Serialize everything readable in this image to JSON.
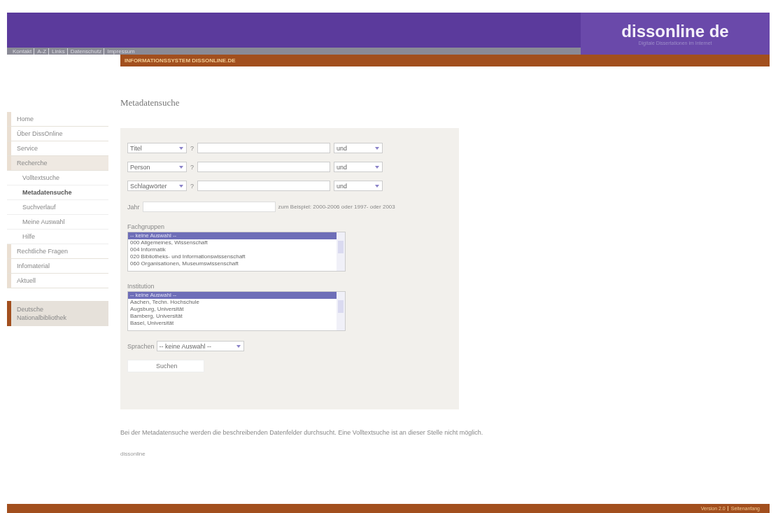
{
  "header": {
    "logo": "dissonline de",
    "tagline": "Digitale Dissertationen im Internet",
    "top_links": [
      "Kontakt",
      "A-Z",
      "Links",
      "Datenschutz",
      "Impressum"
    ],
    "banner": "INFORMATIONSSYSTEM DISSONLINE.DE"
  },
  "sidebar": {
    "items": [
      {
        "label": "Home",
        "selected": false
      },
      {
        "label": "Über DissOnline",
        "selected": false
      },
      {
        "label": "Service",
        "selected": false
      },
      {
        "label": "Recherche",
        "selected": true,
        "children": [
          {
            "label": "Volltextsuche",
            "selected": false
          },
          {
            "label": "Metadatensuche",
            "selected": true
          },
          {
            "label": "Suchverlauf",
            "selected": false
          },
          {
            "label": "Meine Auswahl",
            "selected": false
          },
          {
            "label": "Hilfe",
            "selected": false
          }
        ]
      },
      {
        "label": "Rechtliche Fragen",
        "selected": false
      },
      {
        "label": "Infomaterial",
        "selected": false
      },
      {
        "label": "Aktuell",
        "selected": false
      }
    ],
    "partner": "Deutsche Nationalbibliothek"
  },
  "page_title": "Metadatensuche",
  "search_rows": [
    {
      "field": "Titel",
      "help": "?",
      "operator": "und"
    },
    {
      "field": "Person",
      "help": "?",
      "operator": "und"
    },
    {
      "field": "Schlagwörter",
      "help": "?",
      "operator": "und"
    }
  ],
  "year": {
    "label": "Jahr",
    "hint": "zum Beispiel: 2000-2006 oder 1997- oder 2003"
  },
  "lists": [
    {
      "label": "Fachgruppen",
      "options": [
        {
          "label": "-- keine Auswahl --",
          "selected": true
        },
        {
          "label": "000 Allgemeines, Wissenschaft",
          "selected": false
        },
        {
          "label": "004 Informatik",
          "selected": false
        },
        {
          "label": "020 Bibliotheks- und Informationswissenschaft",
          "selected": false
        },
        {
          "label": "060 Organisationen, Museumswissenschaft",
          "selected": false
        }
      ]
    },
    {
      "label": "Institution",
      "options": [
        {
          "label": "-- keine Auswahl --",
          "selected": true
        },
        {
          "label": "Aachen, Techn. Hochschule",
          "selected": false
        },
        {
          "label": "Augsburg, Universität",
          "selected": false
        },
        {
          "label": "Bamberg, Universität",
          "selected": false
        },
        {
          "label": "Basel, Universität",
          "selected": false
        }
      ]
    }
  ],
  "language": {
    "label": "Sprachen",
    "value": "-- keine Auswahl --"
  },
  "submit": "Suchen",
  "note": "Bei der Metadatensuche werden die beschreibenden Datenfelder durchsucht. Eine Volltextsuche ist an dieser Stelle nicht möglich.",
  "footer_link": "dissonline",
  "footer": {
    "version": "Version 2.0",
    "top_link": "Seitenanfang"
  }
}
